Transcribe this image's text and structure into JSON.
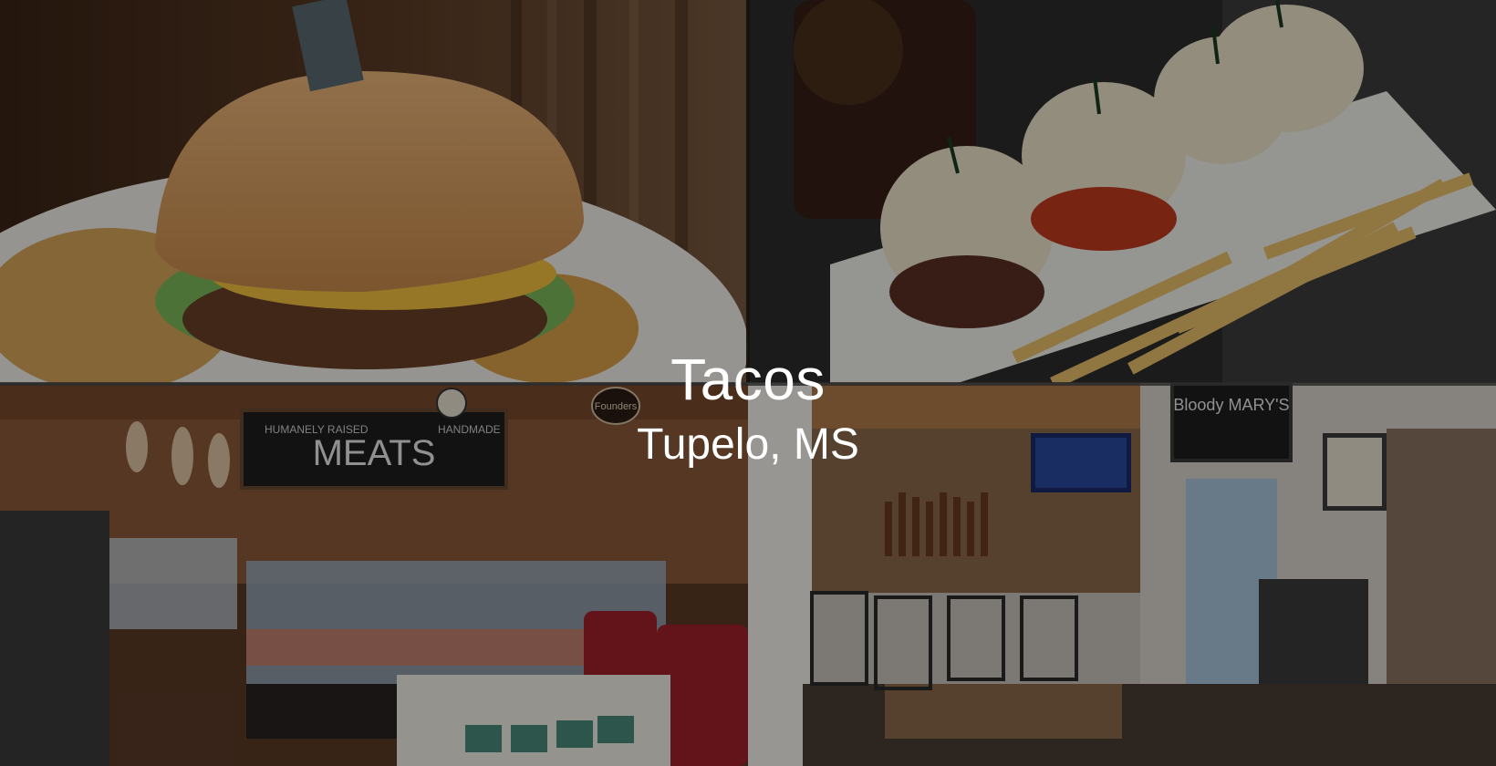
{
  "hero": {
    "title": "Tacos",
    "subtitle": "Tupelo, MS"
  },
  "photos": {
    "burger": {
      "icon": "burger-photo"
    },
    "sliders": {
      "icon": "sliders-photo"
    },
    "butcher_counter": {
      "icon": "butcher-shop-photo",
      "signs": [
        "HUMANELY RAISED",
        "MEATS",
        "HANDMADE",
        "Founders"
      ]
    },
    "bar_interior": {
      "icon": "bar-interior-photo",
      "signs": [
        "Bloody MARY'S"
      ]
    }
  },
  "colors": {
    "overlay": "#000000",
    "text": "#ffffff"
  }
}
